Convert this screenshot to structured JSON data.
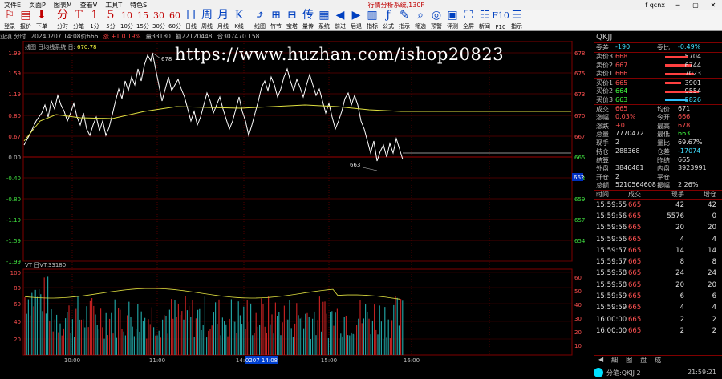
{
  "menu": {
    "items": [
      "文件E",
      "页面P",
      "图表M",
      "查看V",
      "工具T",
      "特色S"
    ],
    "center": "行情分析系统,130F",
    "right": "f qcnx",
    "win": [
      "─",
      "▢",
      "✕"
    ]
  },
  "toolbar": [
    {
      "g": "⚐",
      "l": "登录"
    },
    {
      "g": "▤",
      "l": "报价"
    },
    {
      "g": "⬇",
      "l": "下单"
    },
    {
      "g": "分",
      "l": "分时"
    },
    {
      "g": "T",
      "l": "分笔"
    },
    {
      "g": "1",
      "l": "1分"
    },
    {
      "g": "5",
      "l": "5分"
    },
    {
      "g": "10",
      "l": "10分"
    },
    {
      "g": "15",
      "l": "15分"
    },
    {
      "g": "30",
      "l": "30分"
    },
    {
      "g": "60",
      "l": "60分"
    },
    {
      "g": "日",
      "l": "日线"
    },
    {
      "g": "周",
      "l": "周线"
    },
    {
      "g": "月",
      "l": "月线"
    },
    {
      "g": "K",
      "l": "K线"
    },
    {
      "g": "⤴",
      "l": "线图"
    },
    {
      "g": "⊞",
      "l": "竹节"
    },
    {
      "g": "⊟",
      "l": "宝塔"
    },
    {
      "g": "传",
      "l": "量传"
    },
    {
      "g": "▦",
      "l": "系统"
    },
    {
      "g": "◀",
      "l": "前进"
    },
    {
      "g": "▶",
      "l": "后退"
    },
    {
      "g": "▥",
      "l": "指标"
    },
    {
      "g": "ƒ",
      "l": "公式"
    },
    {
      "g": "✎",
      "l": "指示"
    },
    {
      "g": "⌕",
      "l": "筛选"
    },
    {
      "g": "◎",
      "l": "预警"
    },
    {
      "g": "▣",
      "l": "评测"
    },
    {
      "g": "⛶",
      "l": "全屏"
    },
    {
      "g": "☷",
      "l": "新闻"
    },
    {
      "g": "F10",
      "l": "F10"
    },
    {
      "g": "☰",
      "l": "指示"
    }
  ],
  "info": {
    "name": "亚滇 分时",
    "date": "20240207 14:08价666",
    "chg": "涨 +1 0.19%",
    "vol": "量33180",
    "amt": "额22120448",
    "oi": "合307470 158"
  },
  "chart_labels": {
    "ma_name": "线图 日均线系统 日:",
    "ma_value": "670.78",
    "vt_name": "VT 日VT:33180",
    "time_box": "0207 14:08"
  },
  "price_axis_left": [
    "1.99",
    "1.59",
    "1.19",
    "0.80",
    "0.67",
    "0.00",
    "-0.40",
    "-0.80",
    "-1.19",
    "-1.59",
    "-1.99"
  ],
  "price_axis_right": [
    "678",
    "675",
    "673",
    "670",
    "667",
    "665",
    "662",
    "659",
    "657",
    "654"
  ],
  "cur_price_tag": "662",
  "vol_axis_left": [
    "100",
    "80",
    "60",
    "40",
    "20"
  ],
  "vol_axis_right": [
    "60",
    "50",
    "40",
    "30",
    "20",
    "10"
  ],
  "time_axis": [
    "10:00",
    "11:00",
    "14:00",
    "15:00",
    "16:00"
  ],
  "annot": {
    "high": "678",
    "low": "663"
  },
  "right_panel": {
    "title": "QKJJ",
    "head_left_l": "委差",
    "head_left_v": "-190",
    "head_right_l": "委比",
    "head_right_v": "-0.49%",
    "asks": [
      {
        "l": "卖价3",
        "p": "668",
        "v": "5704",
        "w": 28
      },
      {
        "l": "卖价2",
        "p": "667",
        "v": "6744",
        "w": 34
      },
      {
        "l": "卖价1",
        "p": "666",
        "v": "7023",
        "w": 36
      }
    ],
    "bids": [
      {
        "l": "买价1",
        "p": "665",
        "v": "3901",
        "w": 20,
        "pc": "r",
        "vc": "w"
      },
      {
        "l": "买价2",
        "p": "664",
        "v": "9554",
        "w": 42,
        "pc": "g",
        "vc": "w"
      },
      {
        "l": "买价3",
        "p": "663",
        "v": "5826",
        "w": 28,
        "pc": "g",
        "vc": "c"
      }
    ],
    "stats": [
      {
        "a": "成交",
        "b": "665",
        "bc": "red",
        "c": "均价",
        "d": "671",
        "dc": "wht"
      },
      {
        "a": "涨幅",
        "b": "0.03%",
        "bc": "red",
        "c": "今开",
        "d": "666",
        "dc": "red"
      },
      {
        "a": "涨跌",
        "b": "+0",
        "bc": "red",
        "c": "最高",
        "d": "678",
        "dc": "red"
      },
      {
        "a": "总量",
        "b": "7770472",
        "bc": "wht",
        "c": "最低",
        "d": "663",
        "dc": "grn"
      },
      {
        "a": "现手",
        "b": "2",
        "bc": "wht",
        "c": "量比",
        "d": "69.67%",
        "dc": "wht"
      }
    ],
    "stats2": [
      {
        "a": "持仓",
        "b": "288368",
        "bc": "wht",
        "c": "仓差",
        "d": "-17074",
        "dc": "cyn"
      },
      {
        "a": "结算",
        "b": "",
        "bc": "wht",
        "c": "昨结",
        "d": "665",
        "dc": "wht"
      },
      {
        "a": "外盘",
        "b": "3846481",
        "bc": "wht",
        "c": "内盘",
        "d": "3923991",
        "dc": "wht"
      },
      {
        "a": "开仓",
        "b": "2",
        "bc": "wht",
        "c": "平仓",
        "d": "",
        "dc": "wht"
      },
      {
        "a": "总额",
        "b": "5210564608",
        "bc": "wht",
        "c": "振幅",
        "d": "2.26%",
        "dc": "wht"
      }
    ],
    "tick_head": [
      "时间",
      "成交",
      "现手",
      "增仓"
    ],
    "ticks": [
      {
        "t": "15:59:55",
        "p": "665",
        "q": "42",
        "z": "42"
      },
      {
        "t": "15:59:56",
        "p": "665",
        "q": "5576",
        "z": "0"
      },
      {
        "t": "15:59:56",
        "p": "665",
        "q": "20",
        "z": "20"
      },
      {
        "t": "15:59:56",
        "p": "665",
        "q": "4",
        "z": "4"
      },
      {
        "t": "15:59:57",
        "p": "665",
        "q": "14",
        "z": "14"
      },
      {
        "t": "15:59:57",
        "p": "665",
        "q": "8",
        "z": "8"
      },
      {
        "t": "15:59:58",
        "p": "665",
        "q": "24",
        "z": "24"
      },
      {
        "t": "15:59:58",
        "p": "665",
        "q": "20",
        "z": "20"
      },
      {
        "t": "15:59:59",
        "p": "665",
        "q": "6",
        "z": "6"
      },
      {
        "t": "15:59:59",
        "p": "665",
        "q": "4",
        "z": "4"
      },
      {
        "t": "16:00:00",
        "p": "665",
        "q": "2",
        "z": "2"
      },
      {
        "t": "16:00:00",
        "p": "665",
        "q": "2",
        "z": "2"
      }
    ],
    "tabs": [
      "◀",
      "細",
      "图",
      "盘",
      "成"
    ]
  },
  "status": {
    "text": "分笔:QKJJ 2",
    "clock": "21:59:21"
  },
  "watermark": "https://www.huzhan.com/ishop20823"
}
